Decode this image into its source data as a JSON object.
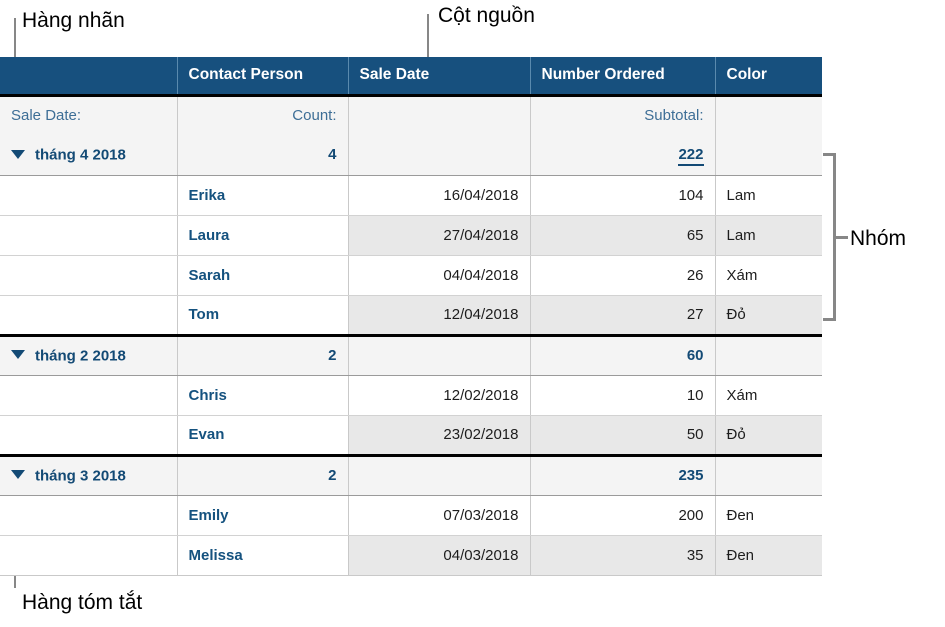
{
  "callouts": {
    "label_row": "Hàng nhãn",
    "source_column": "Cột nguồn",
    "group": "Nhóm",
    "summary_row": "Hàng tóm tắt"
  },
  "table": {
    "columns": [
      "",
      "Contact Person",
      "Sale Date",
      "Number Ordered",
      "Color"
    ],
    "label_row": {
      "category": "Sale Date:",
      "count": "Count:",
      "sale_date": "",
      "subtotal": "Subtotal:",
      "color": ""
    },
    "groups": [
      {
        "name": "tháng 4 2018",
        "count": "4",
        "subtotal": "222",
        "subtotal_selected": true,
        "rows": [
          {
            "blank": "",
            "person": "Erika",
            "date": "16/04/2018",
            "number": "104",
            "color": "Lam"
          },
          {
            "blank": "",
            "person": "Laura",
            "date": "27/04/2018",
            "number": "65",
            "color": "Lam"
          },
          {
            "blank": "",
            "person": "Sarah",
            "date": "04/04/2018",
            "number": "26",
            "color": "Xám"
          },
          {
            "blank": "",
            "person": "Tom",
            "date": "12/04/2018",
            "number": "27",
            "color": "Đỏ"
          }
        ]
      },
      {
        "name": "tháng 2 2018",
        "count": "2",
        "subtotal": "60",
        "subtotal_selected": false,
        "rows": [
          {
            "blank": "",
            "person": "Chris",
            "date": "12/02/2018",
            "number": "10",
            "color": "Xám"
          },
          {
            "blank": "",
            "person": "Evan",
            "date": "23/02/2018",
            "number": "50",
            "color": "Đỏ"
          }
        ]
      },
      {
        "name": "tháng 3 2018",
        "count": "2",
        "subtotal": "235",
        "subtotal_selected": false,
        "rows": [
          {
            "blank": "",
            "person": "Emily",
            "date": "07/03/2018",
            "number": "200",
            "color": "Đen"
          },
          {
            "blank": "",
            "person": "Melissa",
            "date": "04/03/2018",
            "number": "35",
            "color": "Đen"
          }
        ]
      }
    ]
  },
  "colors": {
    "header_bg": "#17507e",
    "group_text": "#134a75",
    "label_text": "#3d6e96",
    "name_text": "#15527f",
    "summary_bg": "#f4f4f4",
    "alt_row_bg": "#e8e8e8",
    "callout_line": "#878787"
  }
}
